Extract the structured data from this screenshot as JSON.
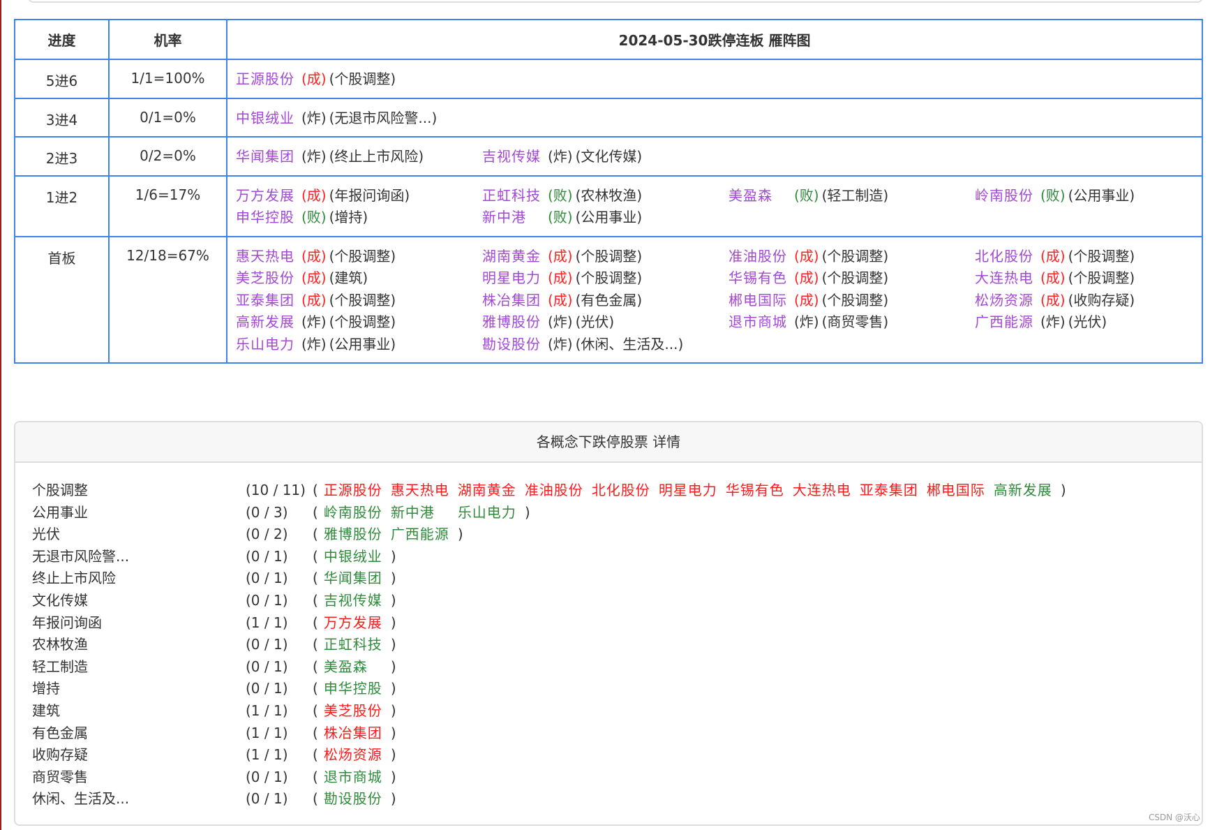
{
  "colors": {
    "border": "#3d82ee",
    "stock_name": "#a347d6",
    "success": "#ff2020",
    "fail": "#2e8b3a",
    "blast": "#333333",
    "detail_success": "#ff1a1a",
    "detail_fail": "#2e8b3a"
  },
  "ladder": {
    "headers": {
      "progress": "进度",
      "rate": "机率",
      "title": "2024-05-30跌停连板 雁阵图"
    },
    "rows": [
      {
        "progress": "5进6",
        "rate": "1/1=100%",
        "items": [
          {
            "name": "正源股份",
            "result": "(成)",
            "type": "success",
            "concept": "(个股调整)"
          }
        ]
      },
      {
        "progress": "3进4",
        "rate": "0/1=0%",
        "items": [
          {
            "name": "中银绒业",
            "result": "(炸)",
            "type": "blast",
            "concept": "(无退市风险警...)"
          }
        ]
      },
      {
        "progress": "2进3",
        "rate": "0/2=0%",
        "items": [
          {
            "name": "华闻集团",
            "result": "(炸)",
            "type": "blast",
            "concept": "(终止上市风险)"
          },
          {
            "name": "吉视传媒",
            "result": "(炸)",
            "type": "blast",
            "concept": "(文化传媒)"
          }
        ]
      },
      {
        "progress": "1进2",
        "rate": "1/6=17%",
        "items": [
          {
            "name": "万方发展",
            "result": "(成)",
            "type": "success",
            "concept": "(年报问询函)"
          },
          {
            "name": "正虹科技",
            "result": "(败)",
            "type": "fail",
            "concept": "(农林牧渔)"
          },
          {
            "name": "美盈森",
            "result": "(败)",
            "type": "fail",
            "concept": "(轻工制造)"
          },
          {
            "name": "岭南股份",
            "result": "(败)",
            "type": "fail",
            "concept": "(公用事业)"
          },
          {
            "name": "申华控股",
            "result": "(败)",
            "type": "fail",
            "concept": "(增持)"
          },
          {
            "name": "新中港",
            "result": "(败)",
            "type": "fail",
            "concept": "(公用事业)"
          }
        ]
      },
      {
        "progress": "首板",
        "rate": "12/18=67%",
        "items": [
          {
            "name": "惠天热电",
            "result": "(成)",
            "type": "success",
            "concept": "(个股调整)"
          },
          {
            "name": "湖南黄金",
            "result": "(成)",
            "type": "success",
            "concept": "(个股调整)"
          },
          {
            "name": "准油股份",
            "result": "(成)",
            "type": "success",
            "concept": "(个股调整)"
          },
          {
            "name": "北化股份",
            "result": "(成)",
            "type": "success",
            "concept": "(个股调整)"
          },
          {
            "name": "美芝股份",
            "result": "(成)",
            "type": "success",
            "concept": "(建筑)"
          },
          {
            "name": "明星电力",
            "result": "(成)",
            "type": "success",
            "concept": "(个股调整)"
          },
          {
            "name": "华锡有色",
            "result": "(成)",
            "type": "success",
            "concept": "(个股调整)"
          },
          {
            "name": "大连热电",
            "result": "(成)",
            "type": "success",
            "concept": "(个股调整)"
          },
          {
            "name": "亚泰集团",
            "result": "(成)",
            "type": "success",
            "concept": "(个股调整)"
          },
          {
            "name": "株冶集团",
            "result": "(成)",
            "type": "success",
            "concept": "(有色金属)"
          },
          {
            "name": "郴电国际",
            "result": "(成)",
            "type": "success",
            "concept": "(个股调整)"
          },
          {
            "name": "松炀资源",
            "result": "(成)",
            "type": "success",
            "concept": "(收购存疑)"
          },
          {
            "name": "高新发展",
            "result": "(炸)",
            "type": "blast",
            "concept": "(个股调整)"
          },
          {
            "name": "雅博股份",
            "result": "(炸)",
            "type": "blast",
            "concept": "(光伏)"
          },
          {
            "name": "退市商城",
            "result": "(炸)",
            "type": "blast",
            "concept": "(商贸零售)"
          },
          {
            "name": "广西能源",
            "result": "(炸)",
            "type": "blast",
            "concept": "(光伏)"
          },
          {
            "name": "乐山电力",
            "result": "(炸)",
            "type": "blast",
            "concept": "(公用事业)"
          },
          {
            "name": "勘设股份",
            "result": "(炸)",
            "type": "blast",
            "concept": "(休闲、生活及...)"
          }
        ]
      }
    ]
  },
  "details": {
    "title": "各概念下跌停股票 详情",
    "open_paren": "(",
    "close_paren": ")",
    "rows": [
      {
        "label": "个股调整",
        "count": "(10 / 11)",
        "stocks": [
          {
            "name": "正源股份",
            "ok": true
          },
          {
            "name": "惠天热电",
            "ok": true
          },
          {
            "name": "湖南黄金",
            "ok": true
          },
          {
            "name": "准油股份",
            "ok": true
          },
          {
            "name": "北化股份",
            "ok": true
          },
          {
            "name": "明星电力",
            "ok": true
          },
          {
            "name": "华锡有色",
            "ok": true
          },
          {
            "name": "大连热电",
            "ok": true
          },
          {
            "name": "亚泰集团",
            "ok": true
          },
          {
            "name": "郴电国际",
            "ok": true
          },
          {
            "name": "高新发展",
            "ok": false
          }
        ]
      },
      {
        "label": "公用事业",
        "count": "(0 / 3)",
        "stocks": [
          {
            "name": "岭南股份",
            "ok": false
          },
          {
            "name": "新中港",
            "ok": false
          },
          {
            "name": "乐山电力",
            "ok": false
          }
        ]
      },
      {
        "label": "光伏",
        "count": "(0 / 2)",
        "stocks": [
          {
            "name": "雅博股份",
            "ok": false
          },
          {
            "name": "广西能源",
            "ok": false
          }
        ]
      },
      {
        "label": "无退市风险警...",
        "count": "(0 / 1)",
        "stocks": [
          {
            "name": "中银绒业",
            "ok": false
          }
        ]
      },
      {
        "label": "终止上市风险",
        "count": "(0 / 1)",
        "stocks": [
          {
            "name": "华闻集团",
            "ok": false
          }
        ]
      },
      {
        "label": "文化传媒",
        "count": "(0 / 1)",
        "stocks": [
          {
            "name": "吉视传媒",
            "ok": false
          }
        ]
      },
      {
        "label": "年报问询函",
        "count": "(1 / 1)",
        "stocks": [
          {
            "name": "万方发展",
            "ok": true
          }
        ]
      },
      {
        "label": "农林牧渔",
        "count": "(0 / 1)",
        "stocks": [
          {
            "name": "正虹科技",
            "ok": false
          }
        ]
      },
      {
        "label": "轻工制造",
        "count": "(0 / 1)",
        "stocks": [
          {
            "name": "美盈森",
            "ok": false
          }
        ]
      },
      {
        "label": "增持",
        "count": "(0 / 1)",
        "stocks": [
          {
            "name": "申华控股",
            "ok": false
          }
        ]
      },
      {
        "label": "建筑",
        "count": "(1 / 1)",
        "stocks": [
          {
            "name": "美芝股份",
            "ok": true
          }
        ]
      },
      {
        "label": "有色金属",
        "count": "(1 / 1)",
        "stocks": [
          {
            "name": "株冶集团",
            "ok": true
          }
        ]
      },
      {
        "label": "收购存疑",
        "count": "(1 / 1)",
        "stocks": [
          {
            "name": "松炀资源",
            "ok": true
          }
        ]
      },
      {
        "label": "商贸零售",
        "count": "(0 / 1)",
        "stocks": [
          {
            "name": "退市商城",
            "ok": false
          }
        ]
      },
      {
        "label": "休闲、生活及...",
        "count": "(0 / 1)",
        "stocks": [
          {
            "name": "勘设股份",
            "ok": false
          }
        ]
      }
    ]
  },
  "watermark": "CSDN @沃心"
}
